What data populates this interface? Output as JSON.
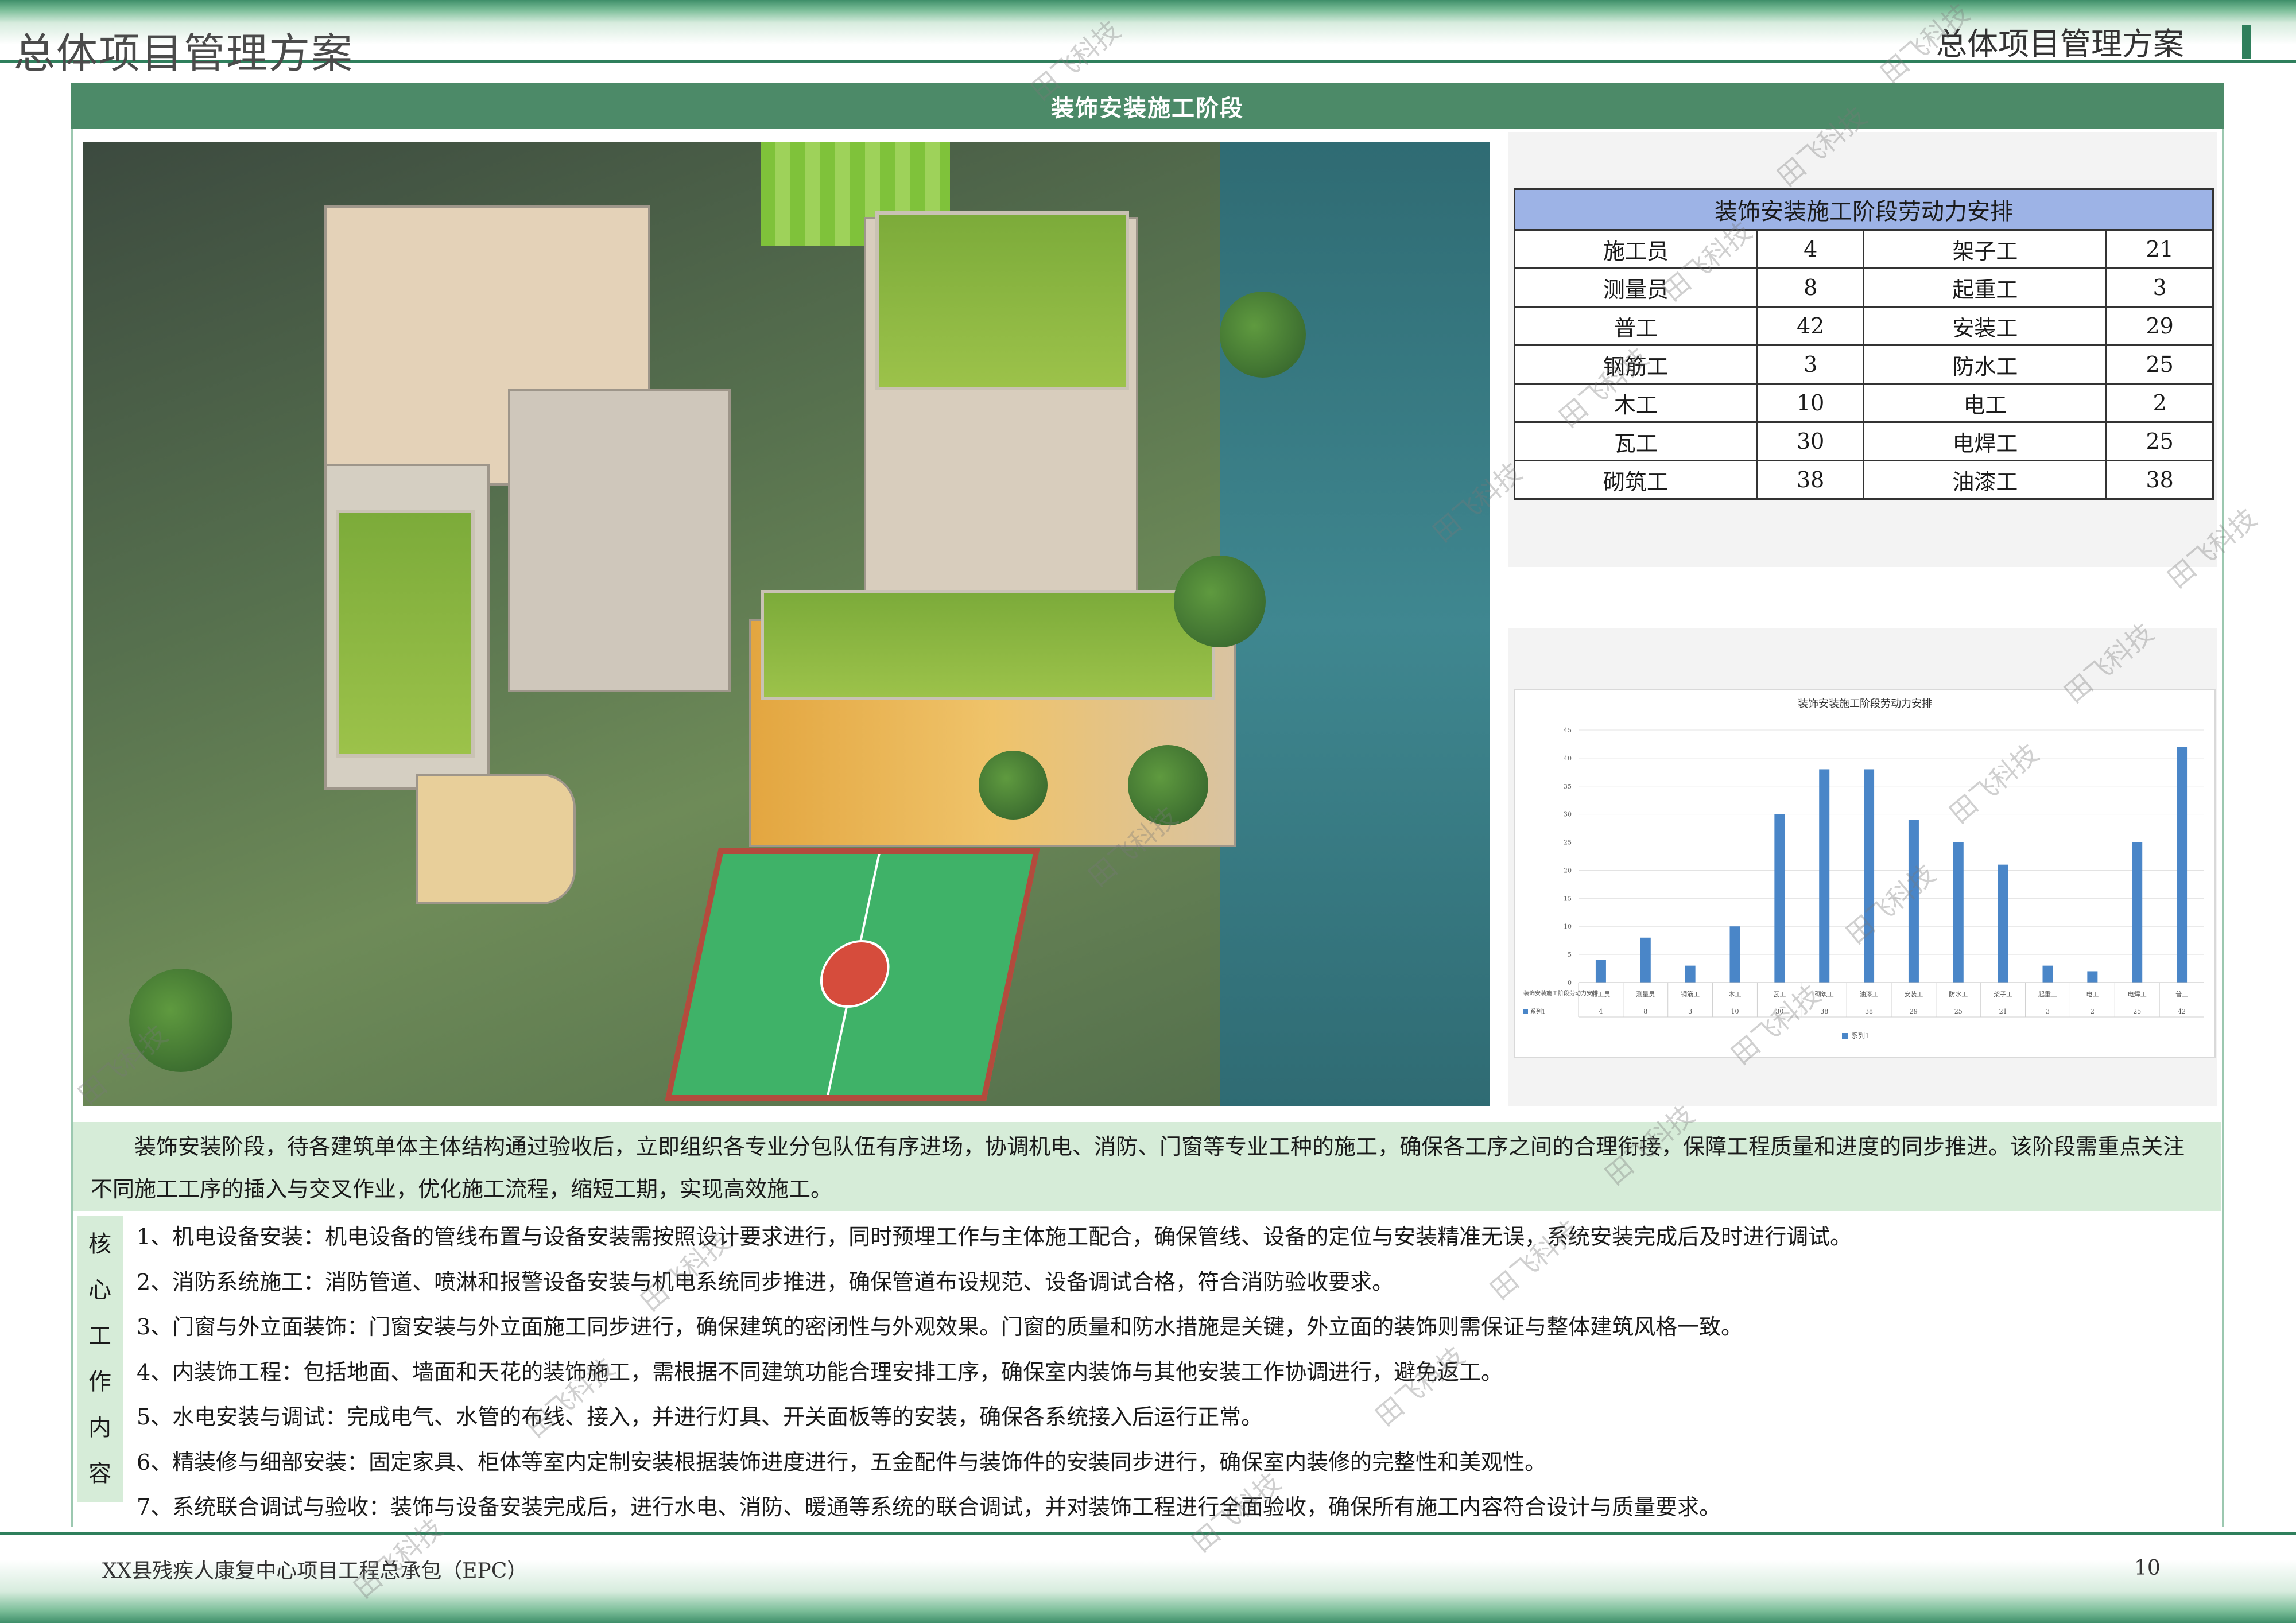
{
  "header": {
    "left_title": "总体项目管理方案",
    "right_title": "总体项目管理方案"
  },
  "section_title": "装饰安装施工阶段",
  "labor_table": {
    "title": "装饰安装施工阶段劳动力安排",
    "rows": [
      {
        "role_a": "施工员",
        "count_a": "4",
        "role_b": "架子工",
        "count_b": "21"
      },
      {
        "role_a": "测量员",
        "count_a": "8",
        "role_b": "起重工",
        "count_b": "3"
      },
      {
        "role_a": "普工",
        "count_a": "42",
        "role_b": "安装工",
        "count_b": "29"
      },
      {
        "role_a": "钢筋工",
        "count_a": "3",
        "role_b": "防水工",
        "count_b": "25"
      },
      {
        "role_a": "木工",
        "count_a": "10",
        "role_b": "电工",
        "count_b": "2"
      },
      {
        "role_a": "瓦工",
        "count_a": "30",
        "role_b": "电焊工",
        "count_b": "25"
      },
      {
        "role_a": "砌筑工",
        "count_a": "38",
        "role_b": "油漆工",
        "count_b": "38"
      }
    ]
  },
  "chart_data": {
    "type": "bar",
    "title": "装饰安装施工阶段劳动力安排",
    "categories": [
      "施工员",
      "测量员",
      "钢筋工",
      "木工",
      "瓦工",
      "砌筑工",
      "油漆工",
      "安装工",
      "防水工",
      "架子工",
      "起重工",
      "电工",
      "电焊工",
      "普工"
    ],
    "series": [
      {
        "name": "系列1",
        "values": [
          4,
          8,
          3,
          10,
          30,
          38,
          38,
          29,
          25,
          21,
          3,
          2,
          25,
          42
        ]
      }
    ],
    "row_header": "装饰安装施工阶段劳动力安排",
    "ylim": [
      0,
      45
    ],
    "yticks": [
      0,
      5,
      10,
      15,
      20,
      25,
      30,
      35,
      40,
      45
    ],
    "legend": "系列1",
    "legend_position": "bottom",
    "grid": true,
    "color": "#4a86c8"
  },
  "description": "装饰安装阶段，待各建筑单体主体结构通过验收后，立即组织各专业分包队伍有序进场，协调机电、消防、门窗等专业工种的施工，确保各工序之间的合理衔接，保障工程质量和进度的同步推进。该阶段需重点关注不同施工工序的插入与交叉作业，优化施工流程，缩短工期，实现高效施工。",
  "core_label": [
    "核",
    "心",
    "工",
    "作",
    "内",
    "容"
  ],
  "core_items": [
    "1、机电设备安装：机电设备的管线布置与设备安装需按照设计要求进行，同时预埋工作与主体施工配合，确保管线、设备的定位与安装精准无误，系统安装完成后及时进行调试。",
    "2、消防系统施工：消防管道、喷淋和报警设备安装与机电系统同步推进，确保管道布设规范、设备调试合格，符合消防验收要求。",
    "3、门窗与外立面装饰：门窗安装与外立面施工同步进行，确保建筑的密闭性与外观效果。门窗的质量和防水措施是关键，外立面的装饰则需保证与整体建筑风格一致。",
    "4、内装饰工程：包括地面、墙面和天花的装饰施工，需根据不同建筑功能合理安排工序，确保室内装饰与其他安装工作协调进行，避免返工。",
    "5、水电安装与调试：完成电气、水管的布线、接入，并进行灯具、开关面板等的安装，确保各系统接入后运行正常。",
    "6、精装修与细部安装：固定家具、柜体等室内定制安装根据装饰进度进行，五金配件与装饰件的安装同步进行，确保室内装修的完整性和美观性。",
    "7、系统联合调试与验收：装饰与设备安装完成后，进行水电、消防、暖通等系统的联合调试，并对装饰工程进行全面验收，确保所有施工内容符合设计与质量要求。"
  ],
  "footer": {
    "project": "XX县残疾人康复中心项目工程总承包（EPC）",
    "page": "10"
  },
  "watermark": "田飞科技"
}
